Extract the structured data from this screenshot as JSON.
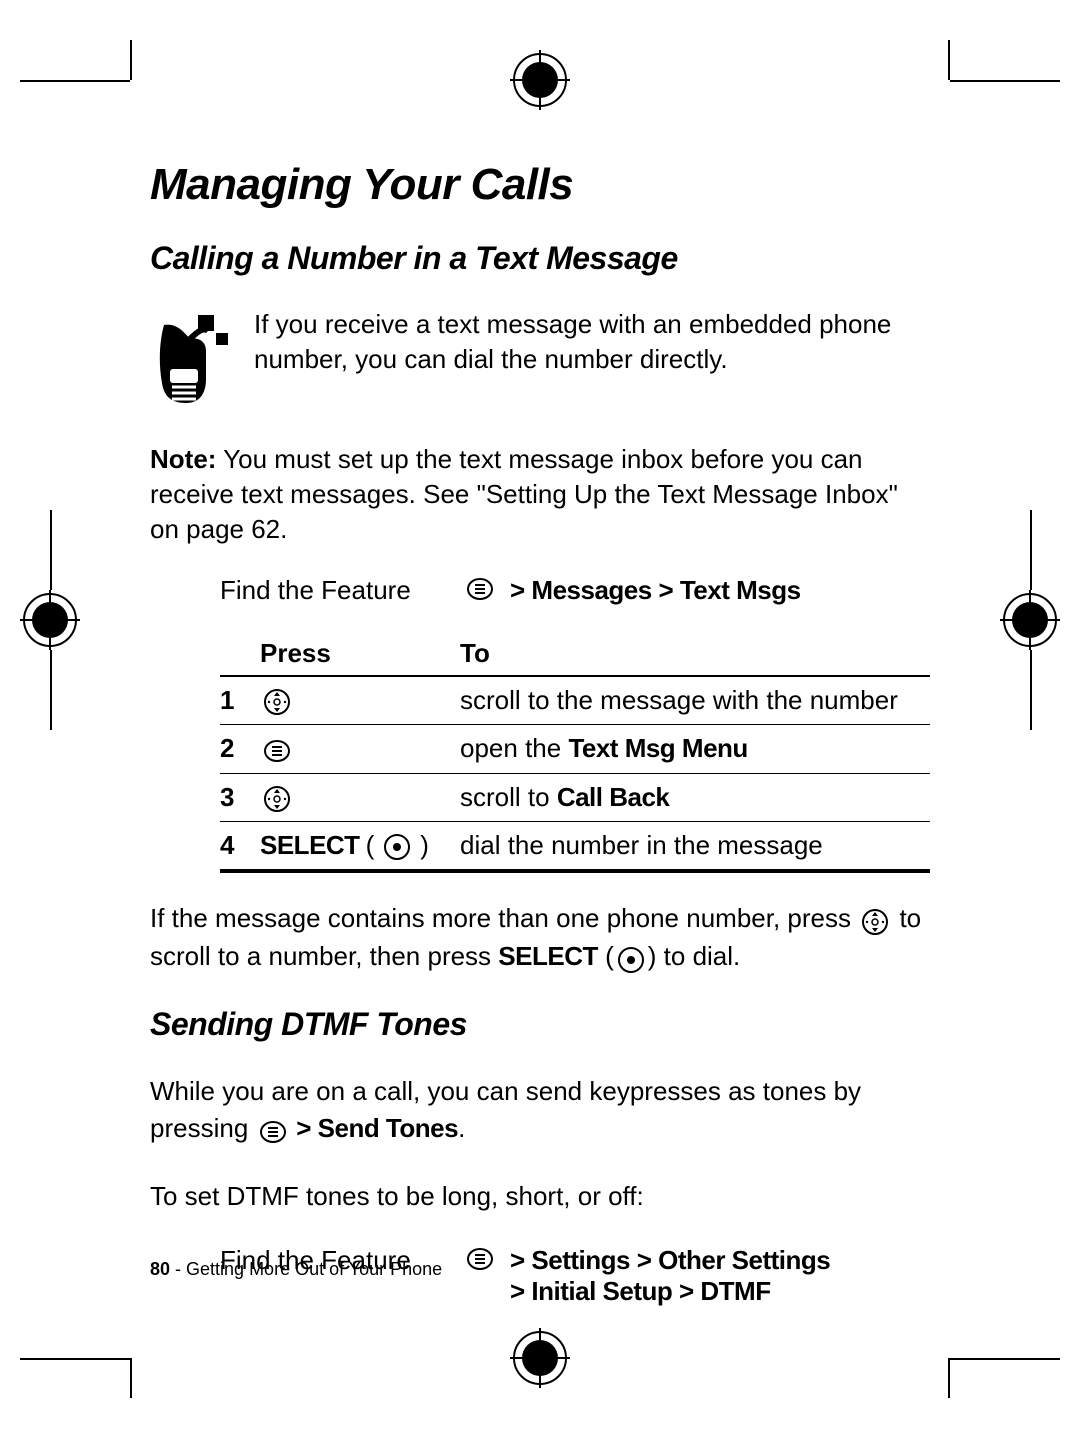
{
  "title": "Managing Your Calls",
  "section1": {
    "heading": "Calling a Number in a Text Message",
    "intro": "If you receive a text message with an embedded phone number, you can dial the number directly.",
    "note_label": "Note:",
    "note_text": " You must set up the text message inbox before you can receive text messages. See \"Setting Up the Text Message Inbox\" on page 62.",
    "find_label": "Find the Feature",
    "path_arrow": ">",
    "path": "Messages > Text Msgs",
    "table": {
      "head_press": "Press",
      "head_to": "To",
      "rows": [
        {
          "n": "1",
          "press_kind": "nav",
          "to_pre": "scroll to the message with the number",
          "to_bold": ""
        },
        {
          "n": "2",
          "press_kind": "menu",
          "to_pre": "open the ",
          "to_bold": "Text Msg Menu"
        },
        {
          "n": "3",
          "press_kind": "nav",
          "to_pre": "scroll to ",
          "to_bold": "Call Back"
        },
        {
          "n": "4",
          "press_kind": "select",
          "press_label": "SELECT",
          "to_pre": "dial the number in the message",
          "to_bold": ""
        }
      ]
    },
    "after_pre": "If the message contains more than one phone number, press ",
    "after_mid": " to scroll to a number, then press ",
    "after_select": "SELECT",
    "after_end": " to dial."
  },
  "section2": {
    "heading": "Sending DTMF Tones",
    "p1_pre": "While you are on a call, you can send keypresses as tones by pressing ",
    "p1_arrow": " > ",
    "p1_bold": "Send Tones",
    "p1_end": ".",
    "p2": "To set DTMF tones to be long, short, or off:",
    "find_label": "Find the Feature",
    "path1": "> Settings > Other Settings",
    "path2": "> Initial Setup > DTMF"
  },
  "footer": {
    "page": "80",
    "sep": " - ",
    "chapter": "Getting More Out of Your Phone"
  }
}
